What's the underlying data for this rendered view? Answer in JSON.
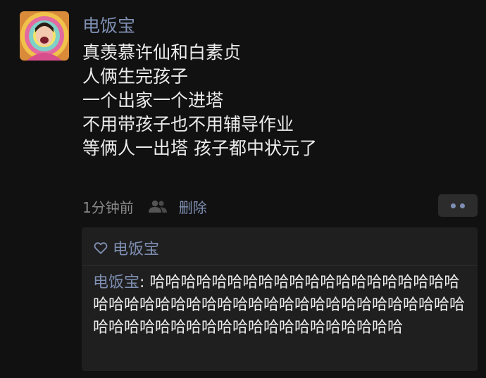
{
  "post": {
    "author": "电饭宝",
    "lines": [
      "真羡慕许仙和白素贞",
      "人俩生完孩子",
      "一个出家一个进塔",
      "不用带孩子也不用辅导作业",
      "等俩人一出塔 孩子都中状元了"
    ],
    "time": "1分钟前",
    "visibility_icon": "people-icon",
    "delete_label": "删除",
    "more_icon": "two-dots-icon"
  },
  "likes": {
    "icon": "heart-outline-icon",
    "names": "电饭宝"
  },
  "comment": {
    "author": "电饭宝",
    "separator": ": ",
    "text": "哈哈哈哈哈哈哈哈哈哈哈哈哈哈哈哈哈哈哈哈哈哈哈哈哈哈哈哈哈哈哈哈哈哈哈哈哈哈哈哈哈哈哈哈哈哈哈哈哈哈哈哈哈哈哈哈哈哈哈哈哈哈哈哈"
  },
  "colors": {
    "background": "#111111",
    "link_blue": "#7f8fb3",
    "comment_bg": "#1f1f1f",
    "text": "#ececec",
    "meta_gray": "#8b8b8b"
  }
}
